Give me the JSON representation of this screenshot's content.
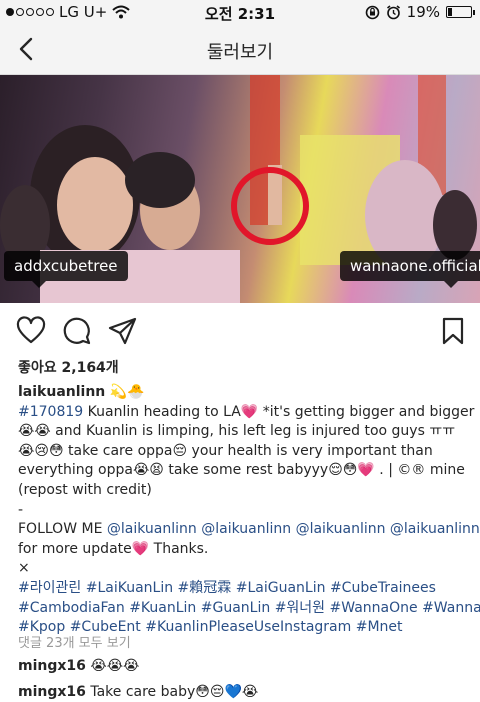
{
  "status_bar": {
    "carrier": "LG U+",
    "time": "오전 2:31",
    "battery": "19%",
    "battery_level": 0.19,
    "signal_full": 1,
    "signal_total": 5
  },
  "header": {
    "title": "둘러보기"
  },
  "photo": {
    "tag_left": "addxcubetree",
    "tag_right": "wannaone.official"
  },
  "post": {
    "likes": "좋아요 2,164개"
  },
  "caption": {
    "username": "laikuanlinn",
    "user_emoji": "💫🐣",
    "lines": [
      "#170819 Kuanlin heading to LA💗  *it's getting bigger and bigger",
      "😭😭 and Kuanlin is limping, his left leg is injured too guys ㅠㅠ",
      "😭😢😳 take care oppa😔 your health is very important than",
      "everything oppa😭😫 take some rest babyyy😌😳💗 . | ©® mine",
      "(repost with credit)",
      "-",
      "FOLLOW ME @laikuanlinn @laikuanlinn @laikuanlinn @laikuanlinn",
      "for more update💗 Thanks.",
      "×",
      "#라이관린 #LaiKuanLin #賴冠霖 #LaiGuanLin #CubeTrainees",
      "#CambodiaFan #KuanLin #GuanLin #워너원 #WannaOne #Wannable",
      "#Kpop #CubeEnt #KuanlinPleaseUseInstagram #Mnet"
    ]
  },
  "view_all_comments": "댓글 23개 모두 보기",
  "comments": [
    {
      "user": "mingx16",
      "text": "😭😭😭"
    },
    {
      "user": "mingx16",
      "text": "Take care baby😳😔💙😭"
    }
  ]
}
